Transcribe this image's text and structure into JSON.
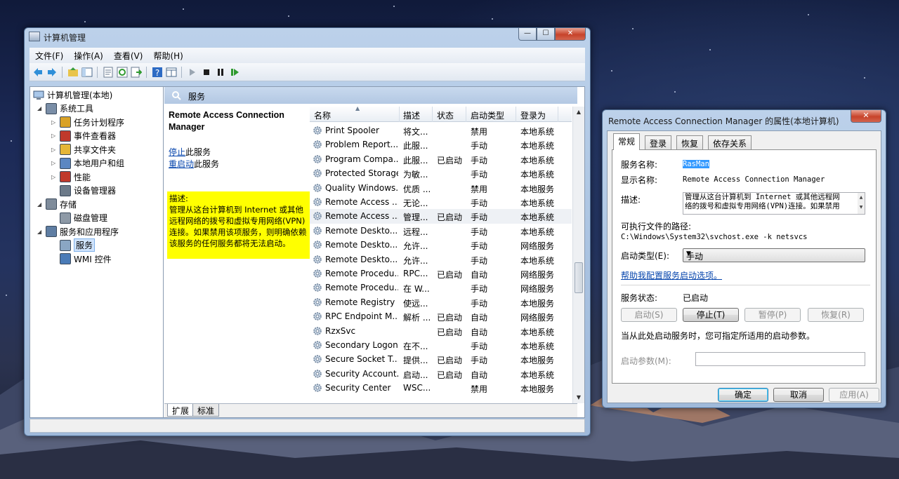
{
  "main_window": {
    "title": "计算机管理",
    "menu": [
      "文件(F)",
      "操作(A)",
      "查看(V)",
      "帮助(H)"
    ],
    "caption_buttons": [
      "minimize",
      "maximize",
      "close"
    ],
    "tree": {
      "root": "计算机管理(本地)",
      "items": [
        {
          "label": "系统工具",
          "icon": "tools-icon",
          "level": 1,
          "expanded": true
        },
        {
          "label": "任务计划程序",
          "icon": "clock-icon",
          "level": 2
        },
        {
          "label": "事件查看器",
          "icon": "event-viewer-icon",
          "level": 2
        },
        {
          "label": "共享文件夹",
          "icon": "shared-folder-icon",
          "level": 2
        },
        {
          "label": "本地用户和组",
          "icon": "users-icon",
          "level": 2
        },
        {
          "label": "性能",
          "icon": "performance-icon",
          "level": 2
        },
        {
          "label": "设备管理器",
          "icon": "device-manager-icon",
          "level": 2
        },
        {
          "label": "存储",
          "icon": "storage-icon",
          "level": 1,
          "expanded": true
        },
        {
          "label": "磁盘管理",
          "icon": "disk-icon",
          "level": 2
        },
        {
          "label": "服务和应用程序",
          "icon": "services-apps-icon",
          "level": 1,
          "expanded": true
        },
        {
          "label": "服务",
          "icon": "services-icon",
          "level": 2,
          "selected": true
        },
        {
          "label": "WMI 控件",
          "icon": "wmi-icon",
          "level": 2
        }
      ]
    },
    "services_header": "服务",
    "detail": {
      "service_title": "Remote Access Connection Manager",
      "stop_link": "停止",
      "stop_suffix": "此服务",
      "restart_link": "重启动",
      "restart_suffix": "此服务",
      "description_label": "描述:",
      "description": "管理从这台计算机到 Internet 或其他远程网络的拨号和虚拟专用网络(VPN)连接。如果禁用该项服务，则明确依赖该服务的任何服务都将无法启动。"
    },
    "columns": [
      "名称",
      "描述",
      "状态",
      "启动类型",
      "登录为"
    ],
    "services": [
      {
        "name": "Print Spooler",
        "desc": "将文...",
        "status": "",
        "startup": "禁用",
        "logon": "本地系统"
      },
      {
        "name": "Problem Report...",
        "desc": "此服...",
        "status": "",
        "startup": "手动",
        "logon": "本地系统"
      },
      {
        "name": "Program Compa...",
        "desc": "此服...",
        "status": "已启动",
        "startup": "手动",
        "logon": "本地系统"
      },
      {
        "name": "Protected Storage",
        "desc": "为敏...",
        "status": "",
        "startup": "手动",
        "logon": "本地系统"
      },
      {
        "name": "Quality Windows...",
        "desc": "优质 ...",
        "status": "",
        "startup": "禁用",
        "logon": "本地服务"
      },
      {
        "name": "Remote Access ...",
        "desc": "无论...",
        "status": "",
        "startup": "手动",
        "logon": "本地系统"
      },
      {
        "name": "Remote Access ...",
        "desc": "管理...",
        "status": "已启动",
        "startup": "手动",
        "logon": "本地系统",
        "selected": true
      },
      {
        "name": "Remote Deskto...",
        "desc": "远程...",
        "status": "",
        "startup": "手动",
        "logon": "本地系统"
      },
      {
        "name": "Remote Deskto...",
        "desc": "允许...",
        "status": "",
        "startup": "手动",
        "logon": "网络服务"
      },
      {
        "name": "Remote Deskto...",
        "desc": "允许...",
        "status": "",
        "startup": "手动",
        "logon": "本地系统"
      },
      {
        "name": "Remote Procedu...",
        "desc": "RPC...",
        "status": "已启动",
        "startup": "自动",
        "logon": "网络服务"
      },
      {
        "name": "Remote Procedu...",
        "desc": "在 W...",
        "status": "",
        "startup": "手动",
        "logon": "网络服务"
      },
      {
        "name": "Remote Registry",
        "desc": "使远...",
        "status": "",
        "startup": "手动",
        "logon": "本地服务"
      },
      {
        "name": "RPC Endpoint M...",
        "desc": "解析 ...",
        "status": "已启动",
        "startup": "自动",
        "logon": "网络服务"
      },
      {
        "name": "RzxSvc",
        "desc": "",
        "status": "已启动",
        "startup": "自动",
        "logon": "本地系统"
      },
      {
        "name": "Secondary Logon",
        "desc": "在不...",
        "status": "",
        "startup": "手动",
        "logon": "本地系统"
      },
      {
        "name": "Secure Socket T...",
        "desc": "提供...",
        "status": "已启动",
        "startup": "手动",
        "logon": "本地服务"
      },
      {
        "name": "Security Account...",
        "desc": "启动...",
        "status": "已启动",
        "startup": "自动",
        "logon": "本地系统"
      },
      {
        "name": "Security Center",
        "desc": "WSC...",
        "status": "",
        "startup": "禁用",
        "logon": "本地服务"
      }
    ],
    "bottom_tabs": [
      "扩展",
      "标准"
    ]
  },
  "dialog": {
    "title": "Remote Access Connection Manager 的属性(本地计算机)",
    "tabs": [
      "常规",
      "登录",
      "恢复",
      "依存关系"
    ],
    "service_name_label": "服务名称:",
    "service_name": "RasMan",
    "display_name_label": "显示名称:",
    "display_name": "Remote Access Connection Manager",
    "description_label": "描述:",
    "description_line1": "管理从这台计算机到 Internet 或其他远程网",
    "description_line2": "络的拨号和虚拟专用网络(VPN)连接。如果禁用",
    "exe_path_label": "可执行文件的路径:",
    "exe_path": "C:\\Windows\\System32\\svchost.exe -k netsvcs",
    "startup_type_label": "启动类型(E):",
    "startup_type": "手动",
    "help_link": "帮助我配置服务启动选项。",
    "status_label": "服务状态:",
    "status_value": "已启动",
    "buttons": {
      "start": "启动(S)",
      "stop": "停止(T)",
      "pause": "暂停(P)",
      "resume": "恢复(R)"
    },
    "start_params_hint": "当从此处启动服务时，您可指定所适用的启动参数。",
    "start_params_label": "启动参数(M):",
    "start_params_value": "",
    "footer": {
      "ok": "确定",
      "cancel": "取消",
      "apply": "应用(A)"
    }
  }
}
